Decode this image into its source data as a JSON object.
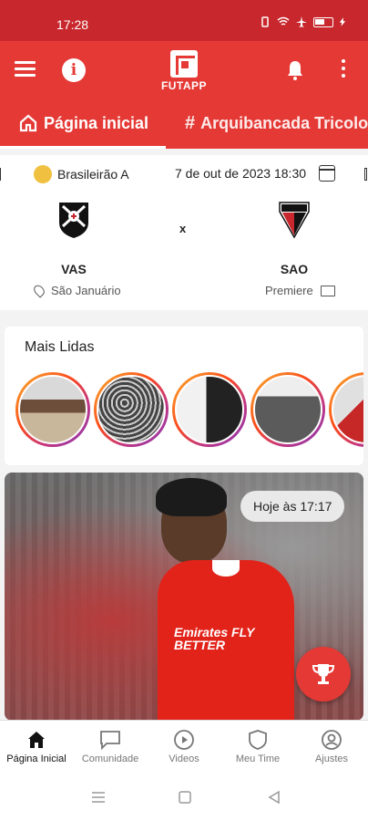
{
  "status_bar": {
    "time": "17:28"
  },
  "app_bar": {
    "logo_text": "FUTAPP"
  },
  "tabs": [
    {
      "label": "Página inicial",
      "active": true
    },
    {
      "label": "Arquibancada Tricolor",
      "active": false
    }
  ],
  "match": {
    "competition": "Brasileirão A",
    "datetime": "7 de out de 2023 18:30",
    "home_team": "VAS",
    "away_team": "SAO",
    "separator": "x",
    "venue": "São Januário",
    "broadcast": "Premiere"
  },
  "mais_lidas": {
    "title": "Mais Lidas"
  },
  "news_card": {
    "time": "Hoje às 17:17",
    "sponsor_text": "Emirates FLY BETTER"
  },
  "bottom_nav": [
    {
      "label": "Página Inicial",
      "icon": "home-icon",
      "active": true
    },
    {
      "label": "Comunidade",
      "icon": "chat-icon",
      "active": false
    },
    {
      "label": "Videos",
      "icon": "play-icon",
      "active": false
    },
    {
      "label": "Meu Time",
      "icon": "shield-icon",
      "active": false
    },
    {
      "label": "Ajustes",
      "icon": "user-settings-icon",
      "active": false
    }
  ],
  "colors": {
    "primary": "#e53935",
    "status_bar": "#c8282d"
  }
}
